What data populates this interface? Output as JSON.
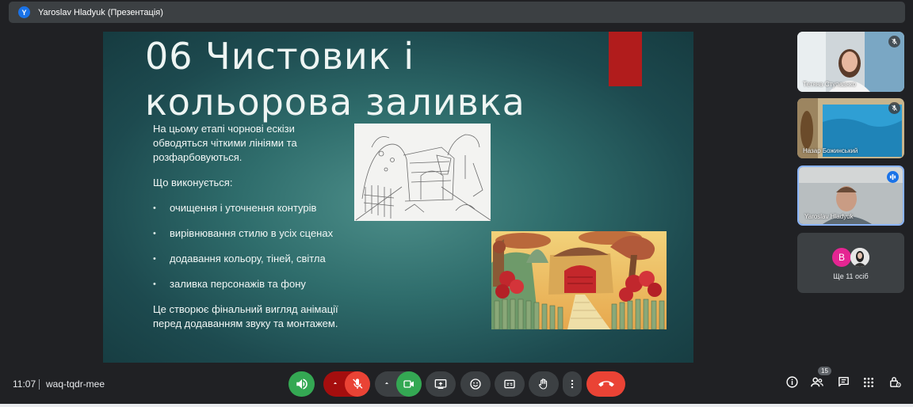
{
  "header": {
    "avatar_letter": "Y",
    "presenter_title": "Yaroslav Hladyuk (Презентація)"
  },
  "slide": {
    "heading_line1": "06 Чистовик і",
    "heading_line2": "кольорова заливка",
    "intro": "На цьому етапі чорнові ескізи обводяться чіткими лініями та розфарбовуються.",
    "question": "Що виконується:",
    "bullets": [
      "очищення і уточнення контурів",
      "вирівнювання стилю в усіх сценах",
      "додавання кольору, тіней, світла",
      "заливка персонажів та фону"
    ],
    "conclusion": "Це створює фінальний вигляд анімації перед додаванням звуку та монтажем."
  },
  "participants": [
    {
      "name": "Тетяна Ступаанко",
      "mic": "muted"
    },
    {
      "name": "Назар Божинський",
      "mic": "muted"
    },
    {
      "name": "Yaroslav Hladyuk",
      "mic": "speaking"
    }
  ],
  "more_participants": {
    "avatar_letter": "В",
    "label": "Ще 11 осіб"
  },
  "bottom_bar": {
    "time": "11:07",
    "meeting_code": "waq-tqdr-mee",
    "people_count": "15"
  },
  "colors": {
    "green": "#34a853",
    "red": "#ea4335",
    "dark_red": "#a50e0e",
    "control_gray": "#3c4043",
    "slide_accent": "#b11c1c"
  },
  "icons": {
    "speaker": "volume-icon",
    "mic": "mic-off-icon",
    "camera": "camera-icon",
    "present": "present-screen-icon",
    "emoji": "emoji-icon",
    "captions": "captions-icon",
    "hand": "raise-hand-icon",
    "more": "more-vert-icon",
    "leave": "call-end-icon",
    "info": "info-icon",
    "people": "people-icon",
    "chat": "chat-icon",
    "activities": "apps-grid-icon",
    "host": "host-controls-icon"
  }
}
